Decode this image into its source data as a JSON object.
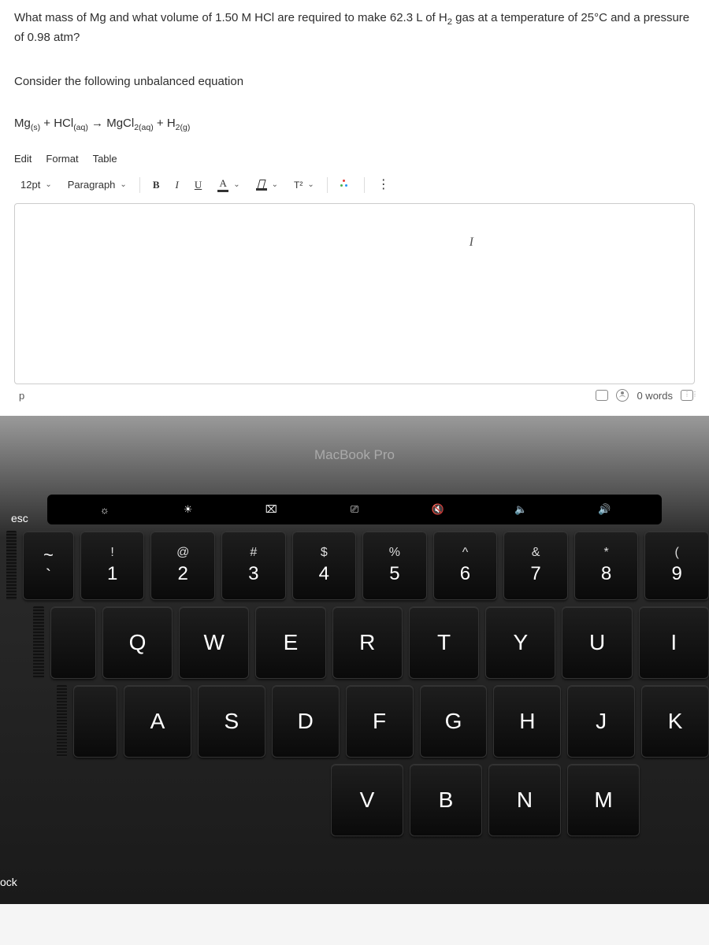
{
  "question_html": "What mass of Mg and what volume of 1.50 M HCl are required to make 62.3 L of H<sub>2</sub> gas at a temperature of 25°C and a pressure of 0.98 atm?",
  "instruction": "Consider the following unbalanced equation",
  "equation_html": "Mg<sub>(s)</sub>  +  HCl<sub>(aq)</sub>  →   MgCl<sub>2(aq)</sub>   +   H<sub>2(g)</sub>",
  "tabs": {
    "edit": "Edit",
    "format": "Format",
    "table": "Table"
  },
  "toolbar": {
    "font_size": "12pt",
    "paragraph": "Paragraph",
    "bold": "B",
    "italic": "I",
    "underline": "U",
    "text_color": "A",
    "superscript": "T²",
    "more": "⋮"
  },
  "cursor_char": "I",
  "status": {
    "p": "p",
    "words": "0 words"
  },
  "laptop_label": "MacBook Pro",
  "touchbar": {
    "esc": "esc",
    "icons": [
      "☼",
      "☀",
      "⌧",
      "⎚",
      "🔇",
      "🔈",
      "🔊"
    ]
  },
  "row1": [
    {
      "u": "!",
      "l": "1"
    },
    {
      "u": "@",
      "l": "2"
    },
    {
      "u": "#",
      "l": "3"
    },
    {
      "u": "$",
      "l": "4"
    },
    {
      "u": "%",
      "l": "5"
    },
    {
      "u": "^",
      "l": "6"
    },
    {
      "u": "&",
      "l": "7"
    },
    {
      "u": "*",
      "l": "8"
    },
    {
      "u": "(",
      "l": "9"
    }
  ],
  "row2": [
    "Q",
    "W",
    "E",
    "R",
    "T",
    "Y",
    "U",
    "I"
  ],
  "row3": [
    "A",
    "S",
    "D",
    "F",
    "G",
    "H",
    "J",
    "K"
  ],
  "row4": [
    "V",
    "B",
    "N",
    "M"
  ],
  "tilde": {
    "u": "~",
    "l": "`"
  },
  "ock": "ock"
}
